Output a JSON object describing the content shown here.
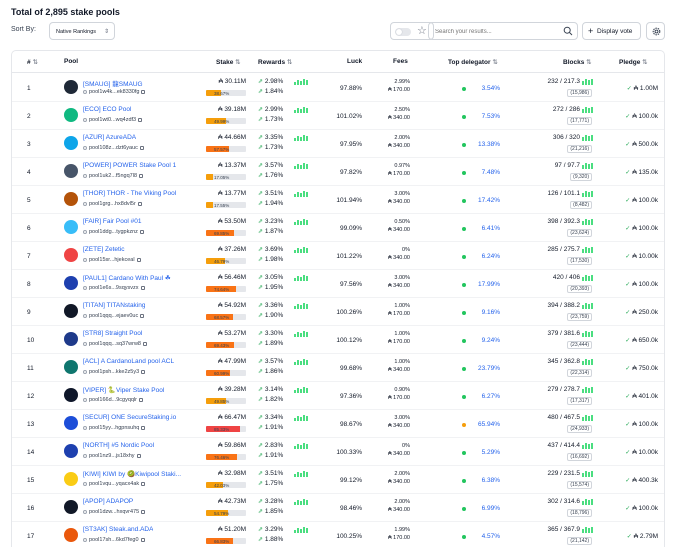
{
  "header": {
    "title": "Total of 2,895 stake pools"
  },
  "toolbar": {
    "sort_label": "Sort By:",
    "sort_value": "Native Rankings",
    "search_placeholder": "Search your results...",
    "vote_label": "Display vote"
  },
  "columns": {
    "num": "#",
    "pool": "Pool",
    "stake": "Stake",
    "rewards": "Rewards",
    "luck": "Luck",
    "fees": "Fees",
    "delegator": "Top delegator",
    "blocks": "Blocks",
    "pledge": "Pledge"
  },
  "colors": {
    "accent": "#2563eb",
    "green": "#22c55e",
    "orange": "#f97316",
    "yellow": "#f59e0b",
    "red": "#ef4444"
  },
  "pools": [
    {
      "num": "1",
      "name": "[SMAUG] 龍SMAUG",
      "id": "pool1w4k...ek8330fg",
      "stake": "₳ 30.11M",
      "sat": "38.67%",
      "sat_pct": 38.67,
      "rew1": "2.98%",
      "rew2": "1.84%",
      "luck": "97.88%",
      "fee_pct": "2.99%",
      "fee_fix": "₳ 170.00",
      "deleg": "3.54%",
      "blocks": "232 / 217.3",
      "blocks_sub": "(15,986)",
      "pledge": "₳ 1.00M",
      "logo": "#1f2937"
    },
    {
      "num": "2",
      "name": "[ECO] ECO Pool",
      "id": "pool1wt0...wq4zdf3",
      "stake": "₳ 39.18M",
      "sat": "49.99%",
      "sat_pct": 49.99,
      "rew1": "2.99%",
      "rew2": "1.73%",
      "luck": "101.02%",
      "fee_pct": "2.50%",
      "fee_fix": "₳ 340.00",
      "deleg": "7.53%",
      "blocks": "272 / 286",
      "blocks_sub": "(17,771)",
      "pledge": "₳ 100.0k",
      "logo": "#10b981"
    },
    {
      "num": "3",
      "name": "[AZUR] AzureADA",
      "id": "pool108z...dzt6yauc",
      "stake": "₳ 44.66M",
      "sat": "57.57%",
      "sat_pct": 57.57,
      "rew1": "3.35%",
      "rew2": "1.73%",
      "luck": "97.95%",
      "fee_pct": "2.00%",
      "fee_fix": "₳ 340.00",
      "deleg": "13.38%",
      "blocks": "306 / 320",
      "blocks_sub": "(21,216)",
      "pledge": "₳ 500.0k",
      "logo": "#0ea5e9"
    },
    {
      "num": "4",
      "name": "[POWER] POWER Stake Pool 1",
      "id": "pool1uk2...f5ngq7l8",
      "stake": "₳ 13.37M",
      "sat": "17.05%",
      "sat_pct": 17.05,
      "rew1": "3.57%",
      "rew2": "1.76%",
      "luck": "97.82%",
      "fee_pct": "0.97%",
      "fee_fix": "₳ 170.00",
      "deleg": "7.48%",
      "blocks": "97 / 97.7",
      "blocks_sub": "(9,320)",
      "pledge": "₳ 135.0k",
      "logo": "#475569"
    },
    {
      "num": "5",
      "name": "[THOR] THOR - The Viking Pool",
      "id": "pool1grg...hx8dvl5r",
      "stake": "₳ 13.77M",
      "sat": "17.55%",
      "sat_pct": 17.55,
      "rew1": "3.51%",
      "rew2": "1.94%",
      "luck": "101.94%",
      "fee_pct": "3.00%",
      "fee_fix": "₳ 340.00",
      "deleg": "17.42%",
      "blocks": "126 / 101.1",
      "blocks_sub": "(8,482)",
      "pledge": "₳ 100.0k",
      "logo": "#b45309"
    },
    {
      "num": "6",
      "name": "[FAIR] Fair Pool #01",
      "id": "pool1ddg...tygpkznz",
      "stake": "₳ 53.50M",
      "sat": "69.85%",
      "sat_pct": 69.85,
      "rew1": "3.23%",
      "rew2": "1.87%",
      "luck": "99.09%",
      "fee_pct": "0.50%",
      "fee_fix": "₳ 340.00",
      "deleg": "6.41%",
      "blocks": "398 / 392.3",
      "blocks_sub": "(23,624)",
      "pledge": "₳ 100.0k",
      "logo": "#38bdf8"
    },
    {
      "num": "7",
      "name": "[ZETE] Zetetic",
      "id": "pool15sr...hjekceal",
      "stake": "₳ 37.26M",
      "sat": "46.79%",
      "sat_pct": 46.79,
      "rew1": "3.69%",
      "rew2": "1.98%",
      "luck": "101.22%",
      "fee_pct": "0%",
      "fee_fix": "₳ 340.00",
      "deleg": "6.24%",
      "blocks": "285 / 275.7",
      "blocks_sub": "(17,530)",
      "pledge": "₳ 10.00k",
      "logo": "#ef4444"
    },
    {
      "num": "8",
      "name": "[PAUL1] Cardano With Paul ☘",
      "id": "pool1e6s...9sqysvzx",
      "stake": "₳ 56.46M",
      "sat": "74.64%",
      "sat_pct": 74.64,
      "rew1": "3.05%",
      "rew2": "1.95%",
      "luck": "97.56%",
      "fee_pct": "3.00%",
      "fee_fix": "₳ 340.00",
      "deleg": "17.99%",
      "blocks": "420 / 406",
      "blocks_sub": "(20,393)",
      "pledge": "₳ 100.0k",
      "logo": "#1e40af"
    },
    {
      "num": "9",
      "name": "[TITAN] TITANstaking",
      "id": "pool1qqq...ejaev0uc",
      "stake": "₳ 54.92M",
      "sat": "68.57%",
      "sat_pct": 68.57,
      "rew1": "3.36%",
      "rew2": "1.90%",
      "luck": "100.26%",
      "fee_pct": "1.00%",
      "fee_fix": "₳ 170.00",
      "deleg": "9.16%",
      "blocks": "394 / 388.2",
      "blocks_sub": "(23,759)",
      "pledge": "₳ 250.0k",
      "logo": "#111827"
    },
    {
      "num": "10",
      "name": "[STR8] Straight Pool",
      "id": "pool1qqq...sq37wrw8",
      "stake": "₳ 53.27M",
      "sat": "69.43%",
      "sat_pct": 69.43,
      "rew1": "3.30%",
      "rew2": "1.89%",
      "luck": "100.12%",
      "fee_pct": "1.00%",
      "fee_fix": "₳ 170.00",
      "deleg": "9.24%",
      "blocks": "379 / 381.6",
      "blocks_sub": "(23,444)",
      "pledge": "₳ 650.0k",
      "logo": "#1e3a8a"
    },
    {
      "num": "11",
      "name": "[ACL] A CardanoLand pool ACL",
      "id": "pool1psh...kke2z5y3",
      "stake": "₳ 47.99M",
      "sat": "60.99%",
      "sat_pct": 60.99,
      "rew1": "3.57%",
      "rew2": "1.86%",
      "luck": "99.68%",
      "fee_pct": "1.00%",
      "fee_fix": "₳ 340.00",
      "deleg": "23.79%",
      "blocks": "345 / 362.8",
      "blocks_sub": "(22,314)",
      "pledge": "₳ 750.0k",
      "logo": "#0f766e"
    },
    {
      "num": "12",
      "name": "[VIPER] 🐍Viper Stake Pool",
      "id": "pool166d...9cgyqqlr",
      "stake": "₳ 39.28M",
      "sat": "49.85%",
      "sat_pct": 49.85,
      "rew1": "3.14%",
      "rew2": "1.82%",
      "luck": "97.36%",
      "fee_pct": "0.90%",
      "fee_fix": "₳ 170.00",
      "deleg": "6.27%",
      "blocks": "279 / 278.7",
      "blocks_sub": "(17,317)",
      "pledge": "₳ 401.0k",
      "logo": "#0f172a"
    },
    {
      "num": "13",
      "name": "[SECUR] ONE SecureStaking.io",
      "id": "pool15yy...hgpnsuhq",
      "stake": "₳ 66.47M",
      "sat": "85.33%",
      "sat_pct": 85.33,
      "rew1": "3.34%",
      "rew2": "1.91%",
      "luck": "98.67%",
      "fee_pct": "3.00%",
      "fee_fix": "₳ 340.00",
      "deleg": "65.94%",
      "blocks": "480 / 467.5",
      "blocks_sub": "(24,933)",
      "pledge": "₳ 100.0k",
      "logo": "#1d4ed8",
      "deleg_dot": "#f59e0b"
    },
    {
      "num": "14",
      "name": "[NORTH] #5 Nordic Pool",
      "id": "pool1nz9...js18xhy",
      "stake": "₳ 59.86M",
      "sat": "76.46%",
      "sat_pct": 76.46,
      "rew1": "2.83%",
      "rew2": "1.91%",
      "luck": "100.33%",
      "fee_pct": "0%",
      "fee_fix": "₳ 340.00",
      "deleg": "5.29%",
      "blocks": "437 / 414.4",
      "blocks_sub": "(16,692)",
      "pledge": "₳ 10.00k",
      "logo": "#1e40af"
    },
    {
      "num": "15",
      "name": "[KIWI] KIWI by 🥝Kiwipool Staki...",
      "id": "pool1vqu...yqacx4ak",
      "stake": "₳ 32.98M",
      "sat": "42.03%",
      "sat_pct": 42.03,
      "rew1": "3.51%",
      "rew2": "1.75%",
      "luck": "99.12%",
      "fee_pct": "2.00%",
      "fee_fix": "₳ 340.00",
      "deleg": "6.38%",
      "blocks": "229 / 231.5",
      "blocks_sub": "(15,574)",
      "pledge": "₳ 400.3k",
      "logo": "#facc15"
    },
    {
      "num": "16",
      "name": "[APOP] ADAPOP",
      "id": "pool1dzw...hxqvr475",
      "stake": "₳ 42.73M",
      "sat": "54.79%",
      "sat_pct": 54.79,
      "rew1": "3.28%",
      "rew2": "1.85%",
      "luck": "98.46%",
      "fee_pct": "2.00%",
      "fee_fix": "₳ 340.00",
      "deleg": "6.99%",
      "blocks": "302 / 314.6",
      "blocks_sub": "(18,796)",
      "pledge": "₳ 100.0k",
      "logo": "#111827"
    },
    {
      "num": "17",
      "name": "[ST3AK] Steak.and.ADA",
      "id": "pool17sh...6kd7feg0",
      "stake": "₳ 51.20M",
      "sat": "66.83%",
      "sat_pct": 66.83,
      "rew1": "3.29%",
      "rew2": "1.88%",
      "luck": "100.25%",
      "fee_pct": "1.99%",
      "fee_fix": "₳ 170.00",
      "deleg": "4.57%",
      "blocks": "365 / 367.9",
      "blocks_sub": "(21,142)",
      "pledge": "₳ 2.79M",
      "logo": "#ea580c"
    }
  ]
}
